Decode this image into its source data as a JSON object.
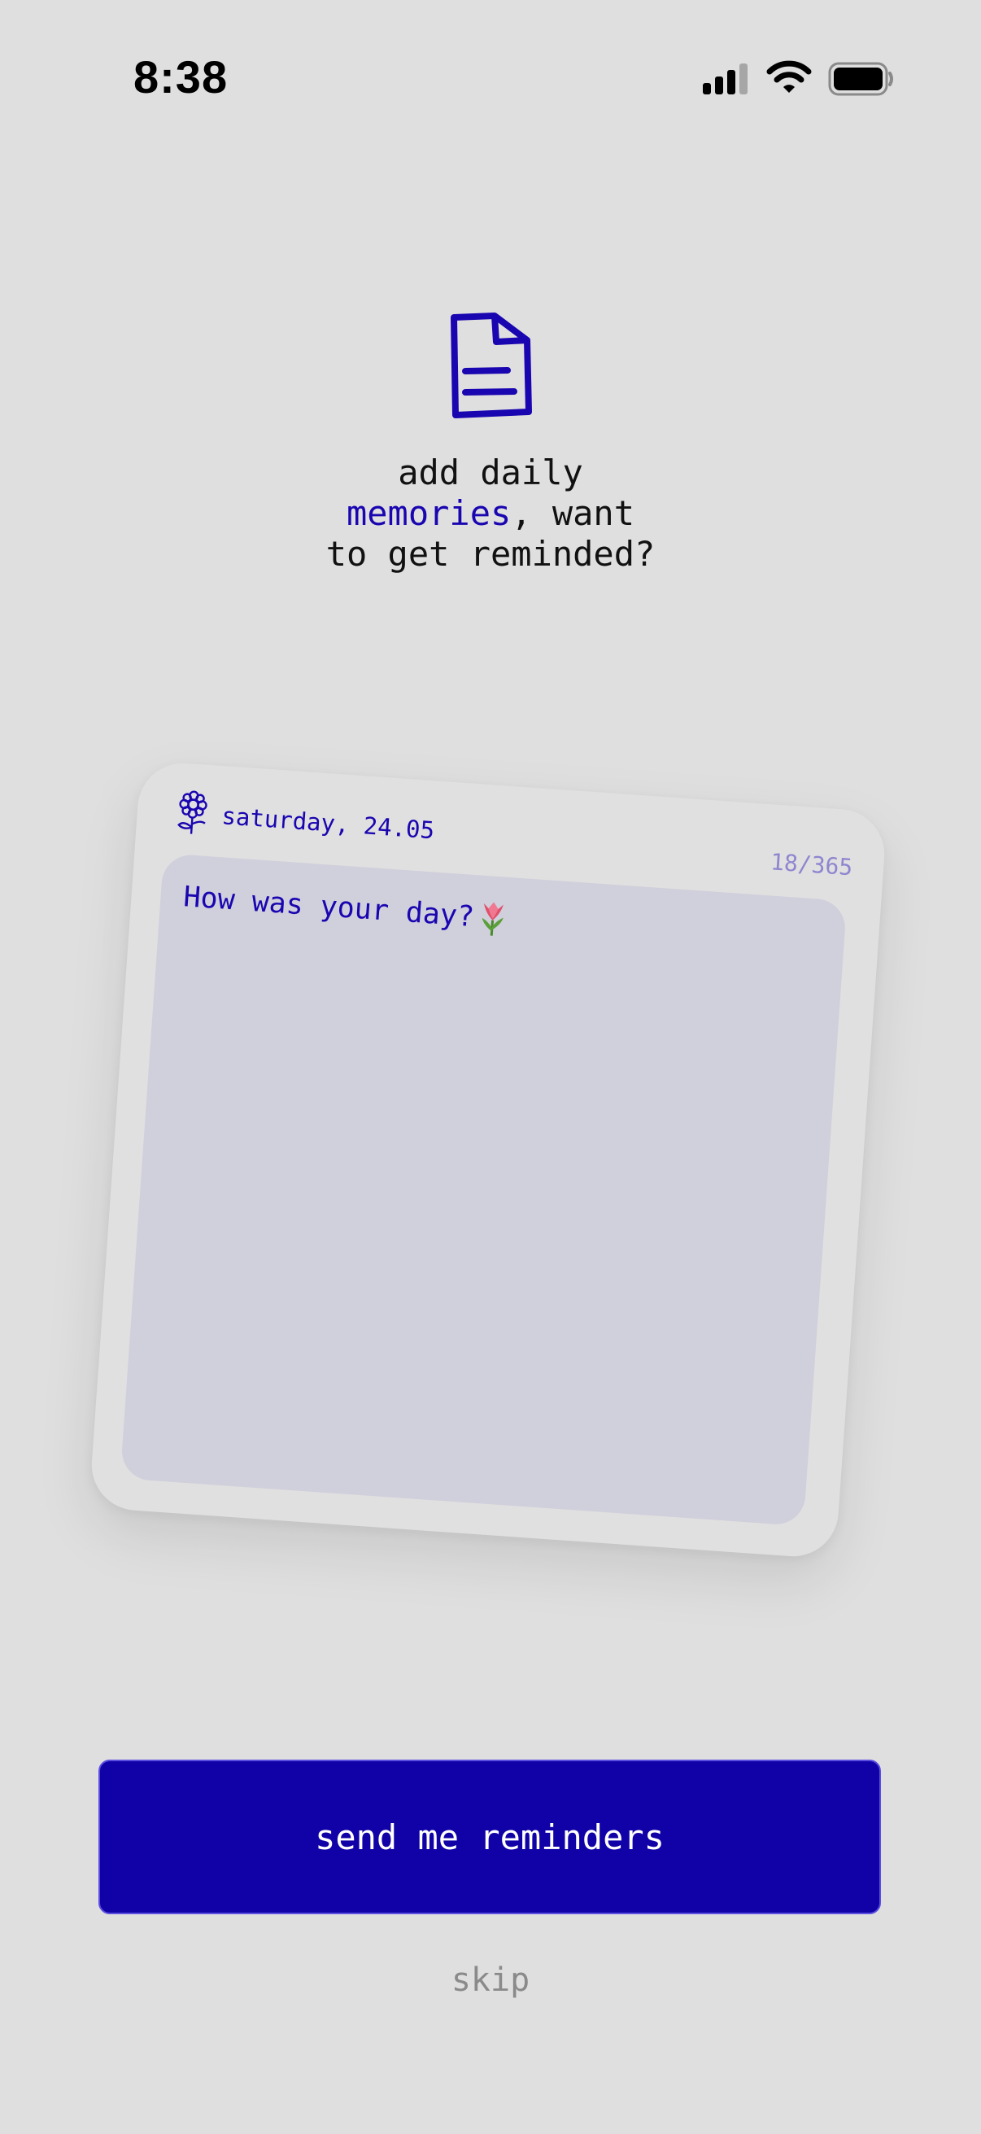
{
  "status_bar": {
    "time": "8:38",
    "icons": [
      "signal-icon",
      "wifi-icon",
      "battery-icon"
    ]
  },
  "header": {
    "icon": "document-icon",
    "line1": "add daily",
    "line2_accent": "memories",
    "line2_rest": ", want",
    "line3": "to get reminded?"
  },
  "card": {
    "icon": "flower-icon",
    "date": "saturday, 24.05",
    "counter": "18/365",
    "prompt": "How was your day?",
    "prompt_icon": "tulip-icon"
  },
  "actions": {
    "primary_label": "send me reminders",
    "skip_label": "skip"
  },
  "colors": {
    "background": "#dfdfdf",
    "accent": "#1a06b0",
    "button": "#1002a6",
    "card_input": "#d0cfdc",
    "muted": "#8a8a8a"
  }
}
